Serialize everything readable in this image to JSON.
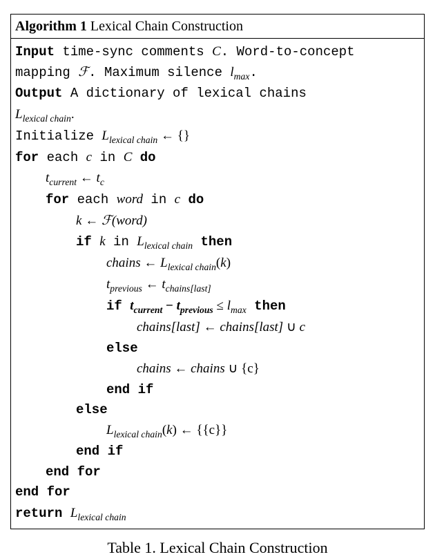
{
  "header": {
    "label_prefix": "Algorithm 1",
    "title_rest": " Lexical Chain Construction"
  },
  "io": {
    "input_kw": "Input",
    "input_l1a": " time-sync comments ",
    "input_C": "C",
    "input_l1b": ". Word-to-concept",
    "input_l2a": "mapping ",
    "input_F": "ℱ",
    "input_l2b": ". Maximum silence ",
    "input_lmax_l": "l",
    "input_lmax_sub": "max",
    "input_l2c": ".",
    "output_kw": "Output",
    "output_txt": " A dictionary of lexical chains",
    "L": "L",
    "L_sub": "lexical chain",
    "period": "."
  },
  "body": {
    "init_a": "Initialize ",
    "gets": " ← ",
    "empty": "{}",
    "for_kw": "for",
    "foreach_a": " each ",
    "c": "c",
    "in_kw": " in ",
    "C": "C",
    "do_kw": " do",
    "t": "t",
    "t_cur_sub": "current",
    "t_c_sub": "c",
    "word": "word",
    "k": "k",
    "F": "ℱ",
    "paren_word": "(word)",
    "if_kw": "if",
    "then_kw": "then",
    "else_kw": "else",
    "endif_kw": "end if",
    "endfor_kw": "end for",
    "return_kw": "return",
    "chains": "chains",
    "Lk_open": "(",
    "Lk_k": "k",
    "Lk_close": ")",
    "t_prev_sub": "previous",
    "chains_last_sub": "chains[last]",
    "minus": " − ",
    "leq": " ≤ ",
    "chains_last": "chains[last]",
    "cup": " ∪ ",
    "set_c": "{c}",
    "set_set_c": "{{c}}"
  },
  "caption": "Table 1. Lexical Chain Construction"
}
